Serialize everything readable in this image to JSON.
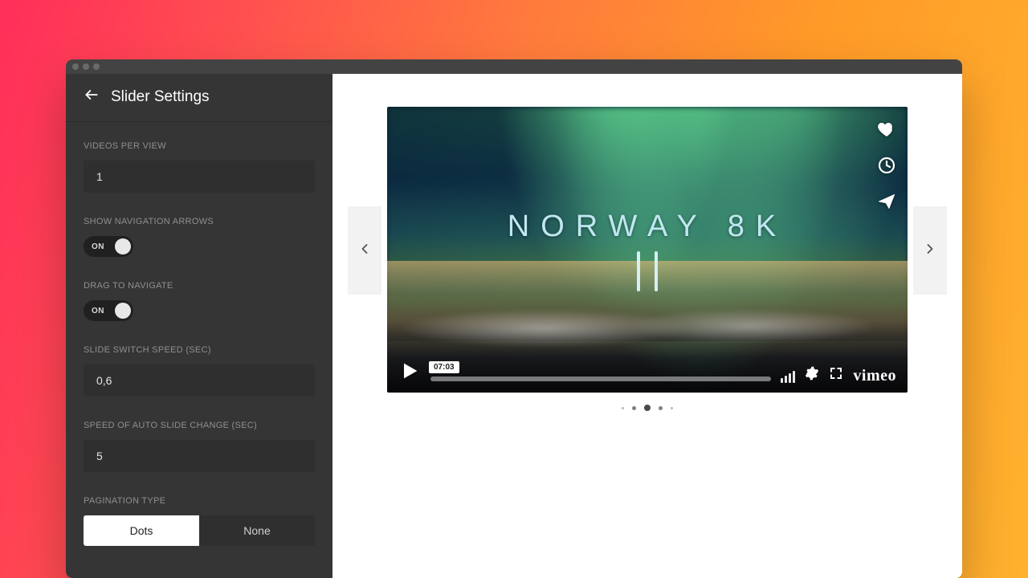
{
  "header": {
    "title": "Slider Settings"
  },
  "settings": {
    "videos_per_view": {
      "label": "VIDEOS PER VIEW",
      "value": "1"
    },
    "show_arrows": {
      "label": "SHOW NAVIGATION ARROWS",
      "state": "ON"
    },
    "drag_nav": {
      "label": "DRAG TO NAVIGATE",
      "state": "ON"
    },
    "switch_speed": {
      "label": "SLIDE SWITCH SPEED (SEC)",
      "value": "0,6"
    },
    "auto_speed": {
      "label": "SPEED OF AUTO SLIDE CHANGE (SEC)",
      "value": "5"
    },
    "pagination": {
      "label": "PAGINATION TYPE",
      "options": {
        "dots": "Dots",
        "none": "None"
      },
      "selected": "dots"
    }
  },
  "video": {
    "title": "NORWAY 8K",
    "duration": "07:03",
    "provider": "vimeo"
  },
  "icons": {
    "back": "arrow-left",
    "prev": "chevron-left",
    "next": "chevron-right",
    "like": "heart",
    "watch_later": "clock",
    "share": "paper-plane",
    "play": "play",
    "settings": "gear",
    "fullscreen": "fullscreen"
  },
  "pagination_dots": {
    "count": 5,
    "active_index": 2
  }
}
